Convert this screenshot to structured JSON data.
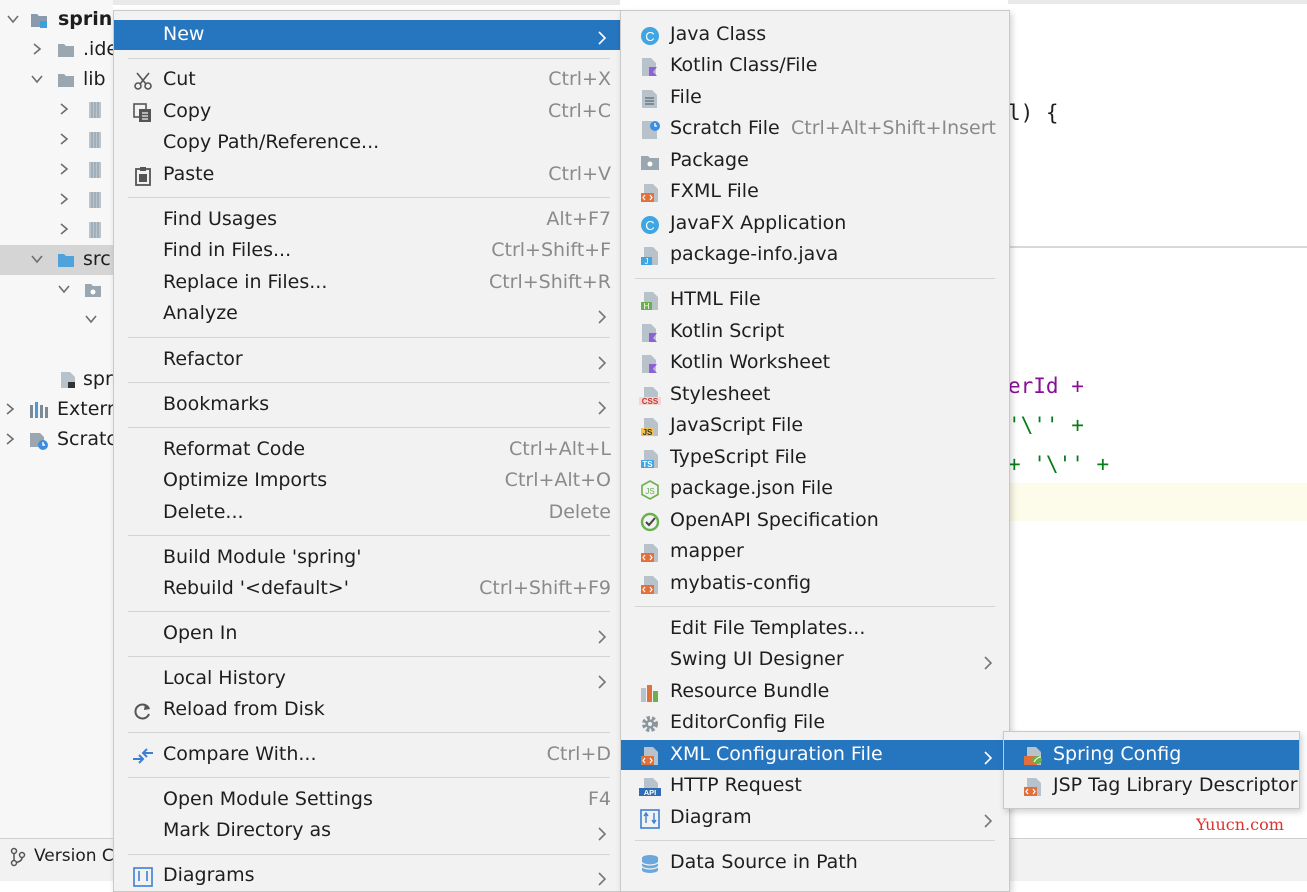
{
  "colors": {
    "selection": "#2675bf",
    "menu_bg": "#f2f2f2",
    "shortcut": "#8a8a8a"
  },
  "project_tree": {
    "rows": [
      {
        "label": "spring"
      },
      {
        "label": ".ide"
      },
      {
        "label": "lib"
      },
      {
        "label": ""
      },
      {
        "label": ""
      },
      {
        "label": ""
      },
      {
        "label": ""
      },
      {
        "label": ""
      },
      {
        "label": "src"
      },
      {
        "label": ""
      },
      {
        "label": ""
      },
      {
        "label": "spr"
      },
      {
        "label": "Extern"
      },
      {
        "label": "Scratcl"
      }
    ]
  },
  "editor": {
    "lines": [
      {
        "text": "l) {"
      },
      {
        "text": "erId +"
      },
      {
        "text": "'\\'' +"
      },
      {
        "text": "+ '\\'' +"
      }
    ]
  },
  "status_bar": {
    "version_control_label": "Version Co"
  },
  "watermark": "Yuucn.com",
  "context_menu": {
    "items": [
      {
        "label": "New",
        "shortcut": "",
        "icon": ""
      },
      {
        "label": "Cut",
        "shortcut": "Ctrl+X",
        "icon": "scissors-icon"
      },
      {
        "label": "Copy",
        "shortcut": "Ctrl+C",
        "icon": "copy-icon"
      },
      {
        "label": "Copy Path/Reference...",
        "shortcut": "",
        "icon": ""
      },
      {
        "label": "Paste",
        "shortcut": "Ctrl+V",
        "icon": "clipboard-icon"
      },
      {
        "label": "Find Usages",
        "shortcut": "Alt+F7",
        "icon": ""
      },
      {
        "label": "Find in Files...",
        "shortcut": "Ctrl+Shift+F",
        "icon": ""
      },
      {
        "label": "Replace in Files...",
        "shortcut": "Ctrl+Shift+R",
        "icon": ""
      },
      {
        "label": "Analyze",
        "shortcut": "",
        "icon": ""
      },
      {
        "label": "Refactor",
        "shortcut": "",
        "icon": ""
      },
      {
        "label": "Bookmarks",
        "shortcut": "",
        "icon": ""
      },
      {
        "label": "Reformat Code",
        "shortcut": "Ctrl+Alt+L",
        "icon": ""
      },
      {
        "label": "Optimize Imports",
        "shortcut": "Ctrl+Alt+O",
        "icon": ""
      },
      {
        "label": "Delete...",
        "shortcut": "Delete",
        "icon": ""
      },
      {
        "label": "Build Module 'spring'",
        "shortcut": "",
        "icon": ""
      },
      {
        "label": "Rebuild '<default>'",
        "shortcut": "Ctrl+Shift+F9",
        "icon": ""
      },
      {
        "label": "Open In",
        "shortcut": "",
        "icon": ""
      },
      {
        "label": "Local History",
        "shortcut": "",
        "icon": ""
      },
      {
        "label": "Reload from Disk",
        "shortcut": "",
        "icon": "reload-icon"
      },
      {
        "label": "Compare With...",
        "shortcut": "Ctrl+D",
        "icon": "compare-arrows-icon"
      },
      {
        "label": "Open Module Settings",
        "shortcut": "F4",
        "icon": ""
      },
      {
        "label": "Mark Directory as",
        "shortcut": "",
        "icon": ""
      },
      {
        "label": "Diagrams",
        "shortcut": "",
        "icon": "diagram-icon"
      }
    ]
  },
  "new_submenu": {
    "items": [
      {
        "label": "Java Class",
        "shortcut": "",
        "icon": "java-class-icon"
      },
      {
        "label": "Kotlin Class/File",
        "shortcut": "",
        "icon": "kotlin-file-icon"
      },
      {
        "label": "File",
        "shortcut": "",
        "icon": "file-icon"
      },
      {
        "label": "Scratch File",
        "shortcut": "Ctrl+Alt+Shift+Insert",
        "icon": "scratch-file-icon"
      },
      {
        "label": "Package",
        "shortcut": "",
        "icon": "package-folder-icon"
      },
      {
        "label": "FXML File",
        "shortcut": "",
        "icon": "fxml-file-icon"
      },
      {
        "label": "JavaFX Application",
        "shortcut": "",
        "icon": "javafx-class-icon"
      },
      {
        "label": "package-info.java",
        "shortcut": "",
        "icon": "java-file-icon"
      },
      {
        "label": "HTML File",
        "shortcut": "",
        "icon": "html-file-icon"
      },
      {
        "label": "Kotlin Script",
        "shortcut": "",
        "icon": "kotlin-script-icon"
      },
      {
        "label": "Kotlin Worksheet",
        "shortcut": "",
        "icon": "kotlin-worksheet-icon"
      },
      {
        "label": "Stylesheet",
        "shortcut": "",
        "icon": "css-file-icon"
      },
      {
        "label": "JavaScript File",
        "shortcut": "",
        "icon": "js-file-icon"
      },
      {
        "label": "TypeScript File",
        "shortcut": "",
        "icon": "ts-file-icon"
      },
      {
        "label": "package.json File",
        "shortcut": "",
        "icon": "nodejs-icon"
      },
      {
        "label": "OpenAPI Specification",
        "shortcut": "",
        "icon": "openapi-icon"
      },
      {
        "label": "mapper",
        "shortcut": "",
        "icon": "xml-file-icon"
      },
      {
        "label": "mybatis-config",
        "shortcut": "",
        "icon": "xml-file-icon"
      },
      {
        "label": "Edit File Templates...",
        "shortcut": "",
        "icon": ""
      },
      {
        "label": "Swing UI Designer",
        "shortcut": "",
        "icon": ""
      },
      {
        "label": "Resource Bundle",
        "shortcut": "",
        "icon": "resource-bundle-icon"
      },
      {
        "label": "EditorConfig File",
        "shortcut": "",
        "icon": "gear-icon"
      },
      {
        "label": "XML Configuration File",
        "shortcut": "",
        "icon": "xml-file-icon"
      },
      {
        "label": "HTTP Request",
        "shortcut": "",
        "icon": "api-file-icon"
      },
      {
        "label": "Diagram",
        "shortcut": "",
        "icon": "diagram-icon"
      },
      {
        "label": "Data Source in Path",
        "shortcut": "",
        "icon": "database-icon"
      }
    ]
  },
  "xml_submenu": {
    "items": [
      {
        "label": "Spring Config",
        "shortcut": "",
        "icon": "spring-config-icon"
      },
      {
        "label": "JSP Tag Library Descriptor",
        "shortcut": "",
        "icon": "xml-file-icon"
      }
    ]
  }
}
